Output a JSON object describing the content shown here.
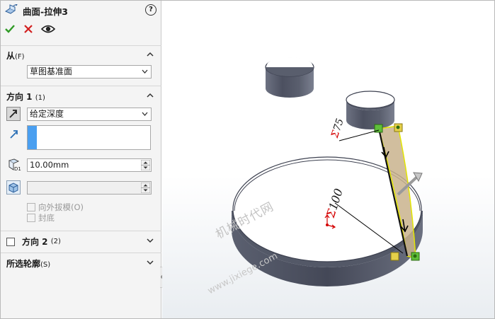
{
  "header": {
    "title": "曲面-拉伸3",
    "help_label": "?"
  },
  "actions": {
    "ok": "✔",
    "cancel": "✕",
    "preview": "preview-icon"
  },
  "from_section": {
    "title": "从",
    "shortcut": "(F)",
    "value": "草图基准面"
  },
  "direction1": {
    "title": "方向 1",
    "shortcut": "(1)",
    "end_condition": "给定深度",
    "depth": "10.00mm",
    "draft_outward_label": "向外拔模",
    "draft_outward_shortcut": "(O)",
    "cap_end_label": "封底"
  },
  "direction2": {
    "title": "方向 2",
    "shortcut": "(2)"
  },
  "contours": {
    "title": "所选轮廓",
    "shortcut": "(S)"
  },
  "viewport": {
    "dim_small": "75",
    "dim_large": "100",
    "dim_prefix": "Σ",
    "watermark": "机械时代网",
    "watermark_url": "www.jixiege.com"
  },
  "colors": {
    "accent_blue": "#4a9ff0",
    "ok_green": "#2f9a25",
    "cancel_red": "#d21f1f",
    "dim_red": "#d40000",
    "surface_dark": "#555a66"
  }
}
